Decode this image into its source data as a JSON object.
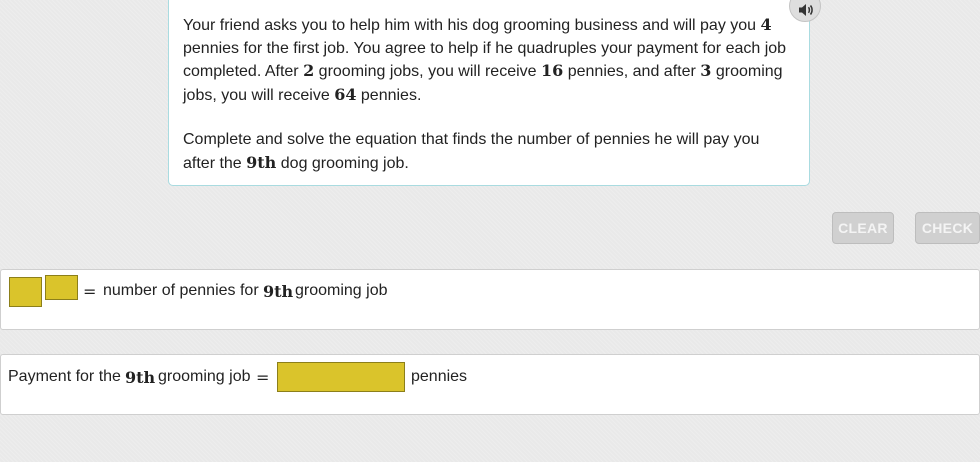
{
  "prompt": {
    "p1_a": "Your friend asks you to help him with his dog grooming business and will pay you",
    "n_first": "4",
    "p1_b": "pennies for the first job. You agree to help if he quadruples your payment for each job completed. After",
    "n_jobs2": "2",
    "p1_c": "grooming jobs, you will receive",
    "n_pay2": "16",
    "p1_d": "pennies, and after",
    "n_jobs3": "3",
    "p1_e": "grooming jobs, you will receive",
    "n_pay3": "64",
    "p1_f": "pennies.",
    "p2_a": "Complete and solve the equation that finds the number of pennies he will pay you after the",
    "ninth": "9th",
    "p2_b": "dog grooming job."
  },
  "audio_icon": "speaker-icon",
  "buttons": {
    "clear": "CLEAR",
    "check": "CHECK"
  },
  "equation": {
    "equals": "=",
    "text_before": "number of pennies for",
    "ninth": "9th",
    "text_after": "grooming job"
  },
  "answer": {
    "label_before": "Payment for the",
    "ninth": "9th",
    "label_after": "grooming job",
    "equals": "=",
    "unit": "pennies"
  },
  "colors": {
    "slot": "#dac42b",
    "prompt_border": "#a9dbe0",
    "button": "#d0d0d0"
  }
}
